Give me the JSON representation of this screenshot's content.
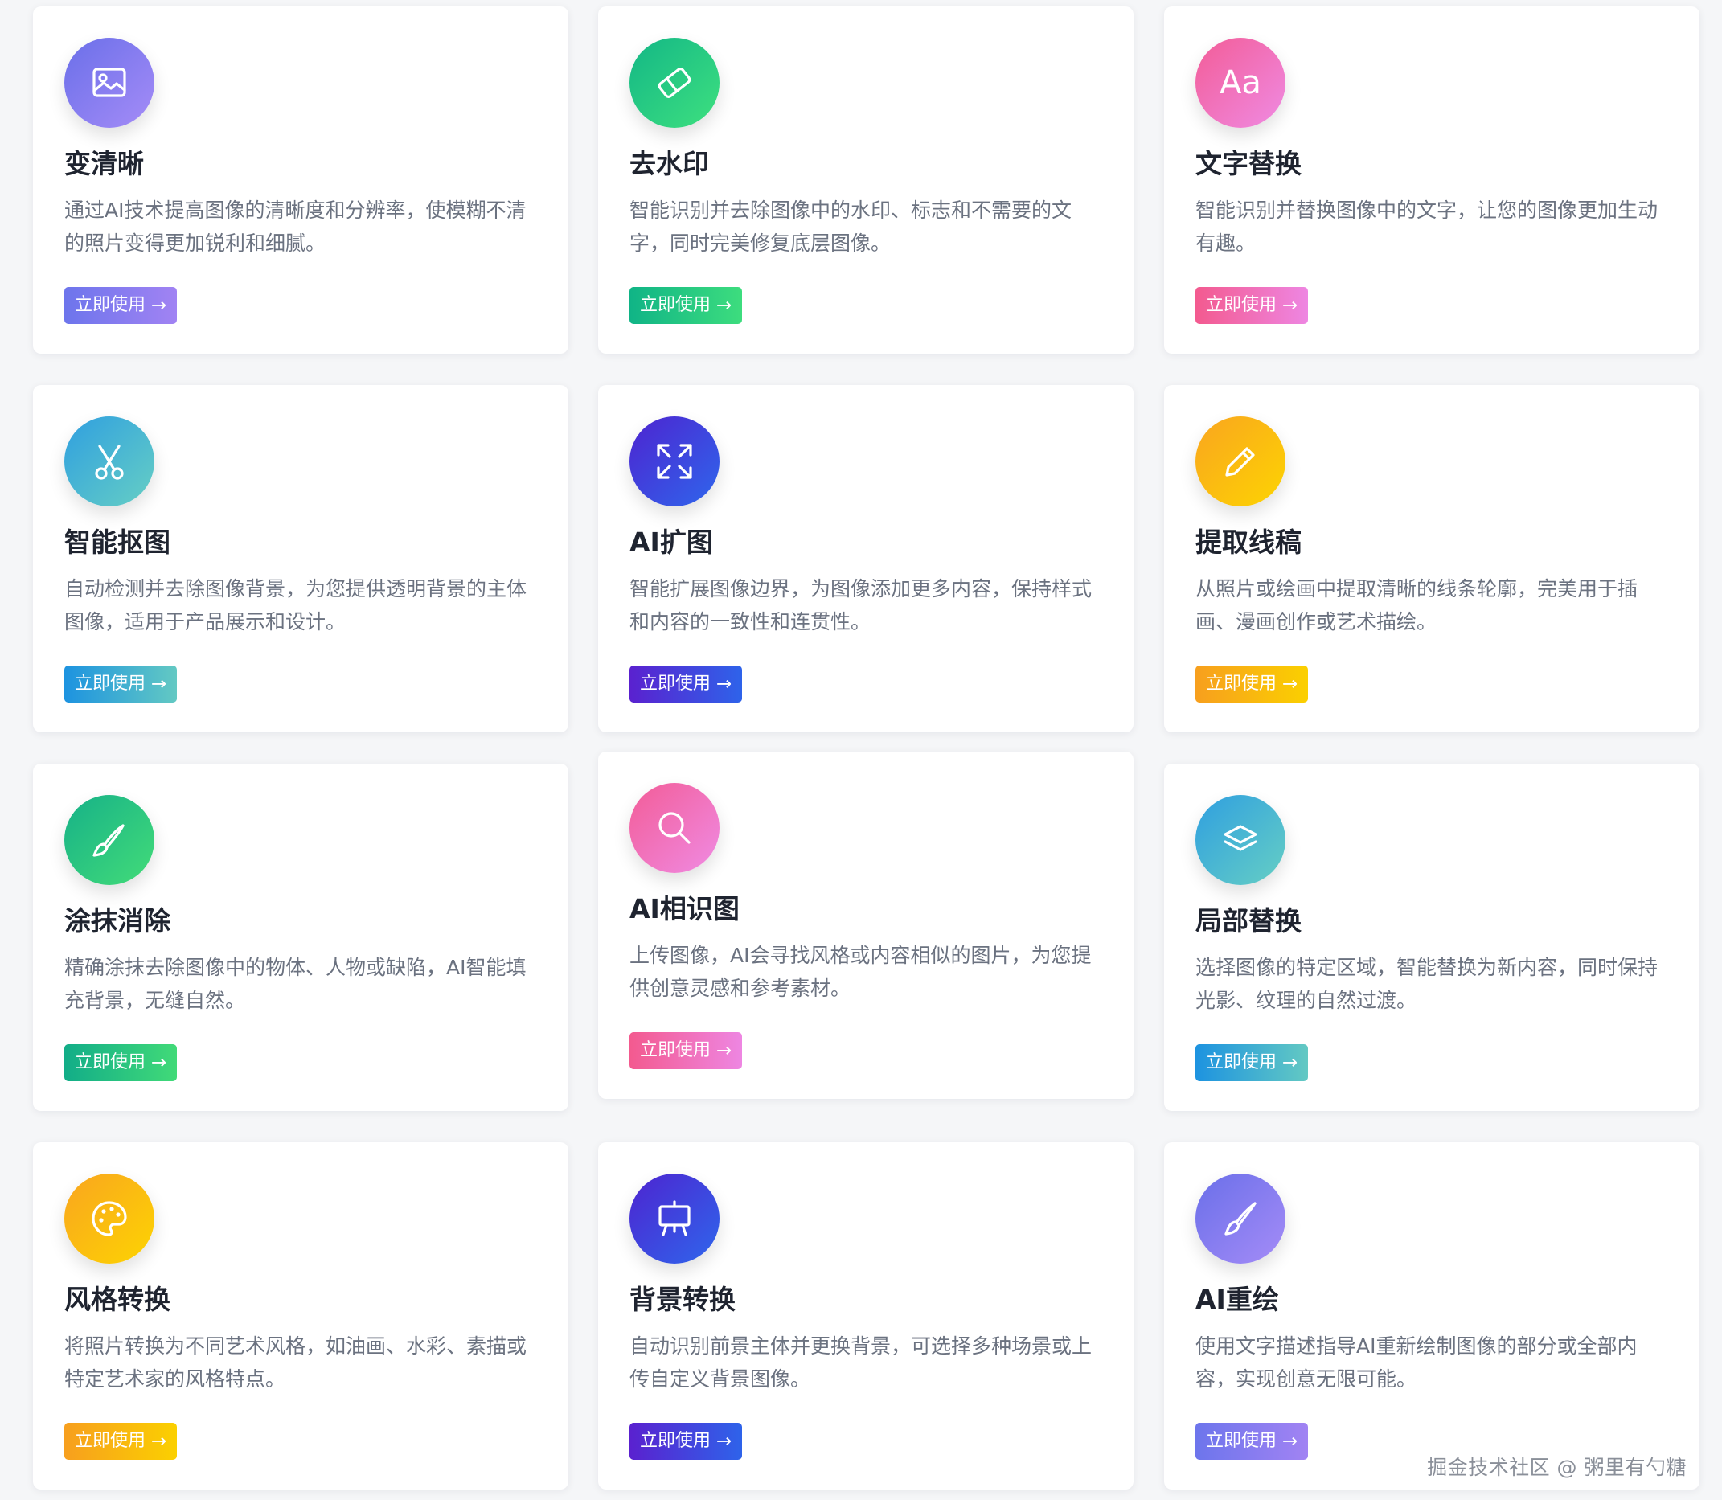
{
  "cards": [
    {
      "title": "变清晰",
      "description": "通过AI技术提高图像的清晰度和分辨率，使模糊不清的照片变得更加锐利和细腻。",
      "button_label": "立即使用",
      "icon": "image-icon",
      "gradient": [
        "#6a6fe9",
        "#a58cf7"
      ],
      "button_gradient": [
        "#6d75ec",
        "#a183f3"
      ]
    },
    {
      "title": "去水印",
      "description": "智能识别并去除图像中的水印、标志和不需要的文字，同时完美修复底层图像。",
      "button_label": "立即使用",
      "icon": "eraser-icon",
      "gradient": [
        "#13b786",
        "#3ee07f"
      ],
      "button_gradient": [
        "#10b486",
        "#3ddd7e"
      ]
    },
    {
      "title": "文字替换",
      "description": "智能识别并替换图像中的文字，让您的图像更加生动有趣。",
      "button_label": "立即使用",
      "icon": "text-icon",
      "icon_text": "Aa",
      "gradient": [
        "#f25c97",
        "#f08be3"
      ],
      "button_gradient": [
        "#f35a8f",
        "#ee86e2"
      ]
    },
    {
      "title": "智能抠图",
      "description": "自动检测并去除图像背景，为您提供透明背景的主体图像，适用于产品展示和设计。",
      "button_label": "立即使用",
      "icon": "scissors-icon",
      "gradient": [
        "#2f9fe0",
        "#66cfc4"
      ],
      "button_gradient": [
        "#1d93e0",
        "#63c9c3"
      ]
    },
    {
      "title": "AI扩图",
      "description": "智能扩展图像边界，为图像添加更多内容，保持样式和内容的一致性和连贯性。",
      "button_label": "立即使用",
      "icon": "expand-icon",
      "gradient": [
        "#4d24d0",
        "#2f66ec"
      ],
      "button_gradient": [
        "#5a21cf",
        "#2e63ea"
      ]
    },
    {
      "title": "提取线稿",
      "description": "从照片或绘画中提取清晰的线条轮廓，完美用于插画、漫画创作或艺术描绘。",
      "button_label": "立即使用",
      "icon": "pencil-icon",
      "gradient": [
        "#f9a51f",
        "#fdd402"
      ],
      "button_gradient": [
        "#f79f1e",
        "#fbd000"
      ]
    },
    {
      "title": "涂抹消除",
      "description": "精确涂抹去除图像中的物体、人物或缺陷，AI智能填充背景，无缝自然。",
      "button_label": "立即使用",
      "icon": "brush-icon",
      "gradient": [
        "#16b188",
        "#43dc78"
      ],
      "button_gradient": [
        "#12ad88",
        "#41da78"
      ]
    },
    {
      "title": "AI相识图",
      "description": "上传图像，AI会寻找风格或内容相似的图片，为您提供创意灵感和参考素材。",
      "button_label": "立即使用",
      "icon": "search-icon",
      "gradient": [
        "#f25c97",
        "#f08be3"
      ],
      "button_gradient": [
        "#f35a8f",
        "#ee86e2"
      ]
    },
    {
      "title": "局部替换",
      "description": "选择图像的特定区域，智能替换为新内容，同时保持光影、纹理的自然过渡。",
      "button_label": "立即使用",
      "icon": "layers-icon",
      "gradient": [
        "#2f9fe0",
        "#66cfc4"
      ],
      "button_gradient": [
        "#1d93e0",
        "#63c9c3"
      ]
    },
    {
      "title": "风格转换",
      "description": "将照片转换为不同艺术风格，如油画、水彩、素描或特定艺术家的风格特点。",
      "button_label": "立即使用",
      "icon": "palette-icon",
      "gradient": [
        "#f9a51f",
        "#fdd402"
      ],
      "button_gradient": [
        "#f79f1e",
        "#fbd000"
      ]
    },
    {
      "title": "背景转换",
      "description": "自动识别前景主体并更换背景，可选择多种场景或上传自定义背景图像。",
      "button_label": "立即使用",
      "icon": "easel-icon",
      "gradient": [
        "#4d24d0",
        "#2f66ec"
      ],
      "button_gradient": [
        "#5a21cf",
        "#2e63ea"
      ]
    },
    {
      "title": "AI重绘",
      "description": "使用文字描述指导AI重新绘制图像的部分或全部内容，实现创意无限可能。",
      "button_label": "立即使用",
      "icon": "paintbrush-icon",
      "gradient": [
        "#6a6fe9",
        "#a58cf7"
      ],
      "button_gradient": [
        "#6d75ec",
        "#a183f3"
      ]
    }
  ],
  "button_arrow": "→",
  "watermark": "掘金技术社区 @ 粥里有勺糖"
}
